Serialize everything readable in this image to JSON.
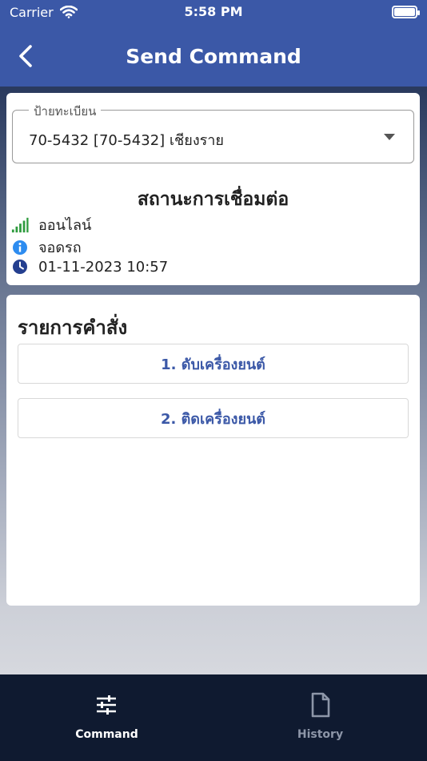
{
  "status_bar": {
    "carrier": "Carrier",
    "time": "5:58 PM"
  },
  "header": {
    "title": "Send Command"
  },
  "vehicle": {
    "plate_label": "ป้ายทะเบียน",
    "plate_value": "70-5432 [70-5432] เชียงราย"
  },
  "connection": {
    "title": "สถานะการเชื่อมต่อ",
    "online_text": "ออนไลน์",
    "state_text": "จอดรถ",
    "timestamp": "01-11-2023 10:57"
  },
  "commands": {
    "title": "รายการคำสั่ง",
    "items": [
      {
        "label": "1. ดับเครื่องยนต์"
      },
      {
        "label": "2. ติดเครื่องยนต์"
      }
    ]
  },
  "tabs": [
    {
      "label": "Command",
      "icon": "sliders-icon",
      "active": true
    },
    {
      "label": "History",
      "icon": "document-icon",
      "active": false
    }
  ],
  "colors": {
    "primary": "#3b58a7",
    "tabbar": "#0f1a30",
    "signal_green": "#2e9b3e",
    "info_blue": "#2d8cf0",
    "clock_navy": "#243f8f",
    "tab_inactive": "#8d96a8"
  }
}
